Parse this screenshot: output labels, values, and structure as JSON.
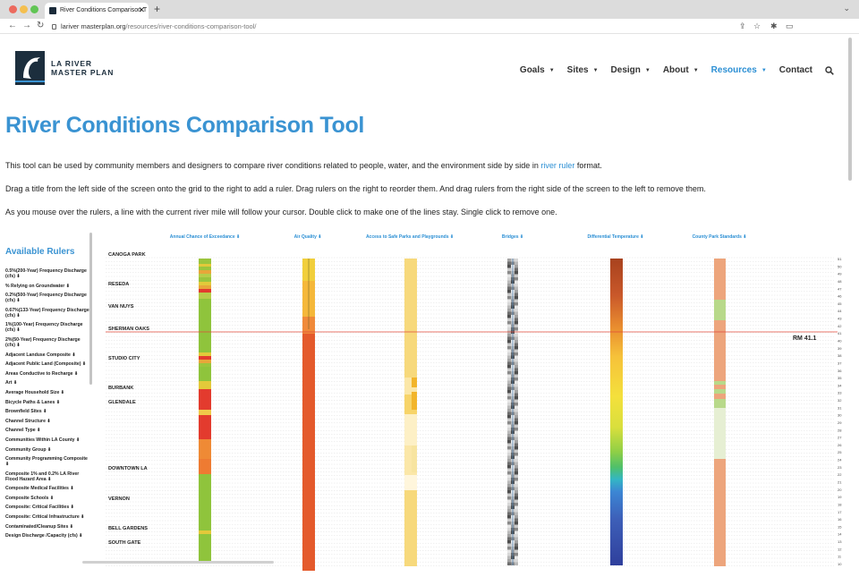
{
  "browser": {
    "tab_title": "River Conditions Comparison T",
    "tab_close": "✕",
    "new_tab": "+",
    "url_host": "lariver masterplan.org",
    "url_path": "/resources/river-conditions-comparison-tool/"
  },
  "header": {
    "logo_line1": "LA RIVER",
    "logo_line2": "MASTER PLAN",
    "nav": [
      {
        "label": "Goals",
        "caret": true,
        "active": false
      },
      {
        "label": "Sites",
        "caret": true,
        "active": false
      },
      {
        "label": "Design",
        "caret": true,
        "active": false
      },
      {
        "label": "About",
        "caret": true,
        "active": false
      },
      {
        "label": "Resources",
        "caret": true,
        "active": true
      },
      {
        "label": "Contact",
        "caret": false,
        "active": false
      }
    ]
  },
  "page": {
    "title": "River Conditions Comparison Tool",
    "intro_before_link": "This tool can be used by community members and designers to compare river conditions related to people, water, and the environment side by side in",
    "intro_link": "river ruler",
    "intro_after_link": "format.",
    "instructions_1": "Drag a title from the left side of the screen onto the grid to the right to add a ruler. Drag rulers on the right to reorder them. And drag rulers from the right side of the screen to the left to remove them.",
    "instructions_2": "As you mouse over the rulers, a line with the current river mile will follow your cursor. Double click to make one of the lines stay. Single click to remove one."
  },
  "sidebar": {
    "title": "Available Rulers",
    "items": [
      "0.5%(200-Year) Frequency Discharge (cfs)",
      "% Relying on Groundwater",
      "0.2%(500-Year) Frequency Discharge (cfs)",
      "0.67%(133-Year) Frequency Discharge (cfs)",
      "1%(100-Year) Frequency Discharge (cfs)",
      "2%(50-Year) Frequency Discharge (cfs)",
      "Adjacent Landuse Composite",
      "Adjacent Public Land (Composite)",
      "Areas Conductive to Recharge",
      "Art",
      "Average Household Size",
      "Bicycle Paths & Lanes",
      "Brownfield Sites",
      "Channel Structure",
      "Channel Type",
      "Communities Within LA County",
      "Community Group",
      "Community Programming Composite",
      "Composite 1% and 0.2% LA River Flood Hazard Area",
      "Composite Medical Facilities",
      "Composite Schools",
      "Composite: Critical Facilities",
      "Composite: Critical Infrastructure",
      "Contaminated/Cleanup Sites",
      "Design Discharge /Capacity (cfs)"
    ]
  },
  "grid": {
    "rulers": [
      "Annual Chance of Exceedance",
      "Air Quality",
      "Access to Safe Parks and Playgrounds",
      "Bridges",
      "Differential Temperature",
      "County Park Standards"
    ],
    "places": [
      "CANOGA PARK",
      "RESEDA",
      "VAN NUYS",
      "SHERMAN OAKS",
      "STUDIO CITY",
      "BURBANK",
      "GLENDALE",
      "DOWNTOWN LA",
      "VERNON",
      "BELL GARDENS",
      "SOUTH GATE"
    ],
    "cursor_label": "RM 41.1",
    "river_miles": [
      "51",
      "50",
      "49",
      "48",
      "47",
      "46",
      "45",
      "44",
      "43",
      "42",
      "41",
      "40",
      "39",
      "38",
      "37",
      "36",
      "35",
      "34",
      "33",
      "32",
      "31",
      "30",
      "29",
      "28",
      "27",
      "26",
      "25",
      "24",
      "23",
      "22",
      "21",
      "20",
      "19",
      "18",
      "17",
      "16",
      "15",
      "14",
      "13",
      "12",
      "11",
      "10"
    ]
  },
  "colors": {
    "accent": "#3a93d2",
    "brand_dark": "#1c2e3d",
    "cursor_line": "#e04a3a"
  }
}
